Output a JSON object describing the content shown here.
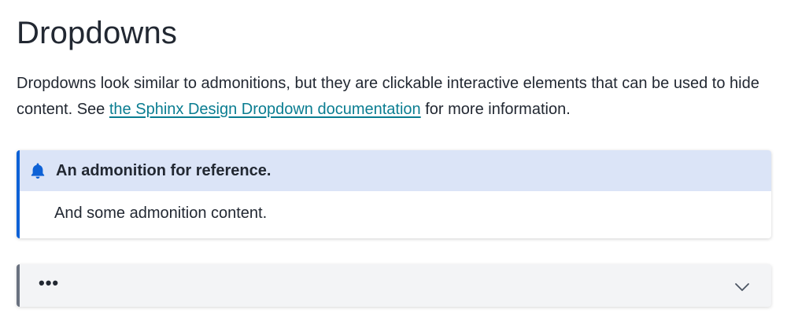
{
  "page": {
    "title": "Dropdowns",
    "intro_before_link": "Dropdowns look similar to admonitions, but they are clickable interactive elements that can be used to hide content. See ",
    "intro_link": "the Sphinx Design Dropdown documentation",
    "intro_after_link": " for more information."
  },
  "admonition": {
    "icon": "bell-icon",
    "title": "An admonition for reference.",
    "body": "And some admonition content.",
    "accent_color": "#0d61d6",
    "title_bg_color": "#dbe4f7"
  },
  "dropdown": {
    "summary": "•••",
    "icon": "chevron-down-icon",
    "accent_color": "#6a7280",
    "bg_color": "#f3f4f6"
  },
  "colors": {
    "link": "#0a7d91",
    "text": "#222832"
  }
}
